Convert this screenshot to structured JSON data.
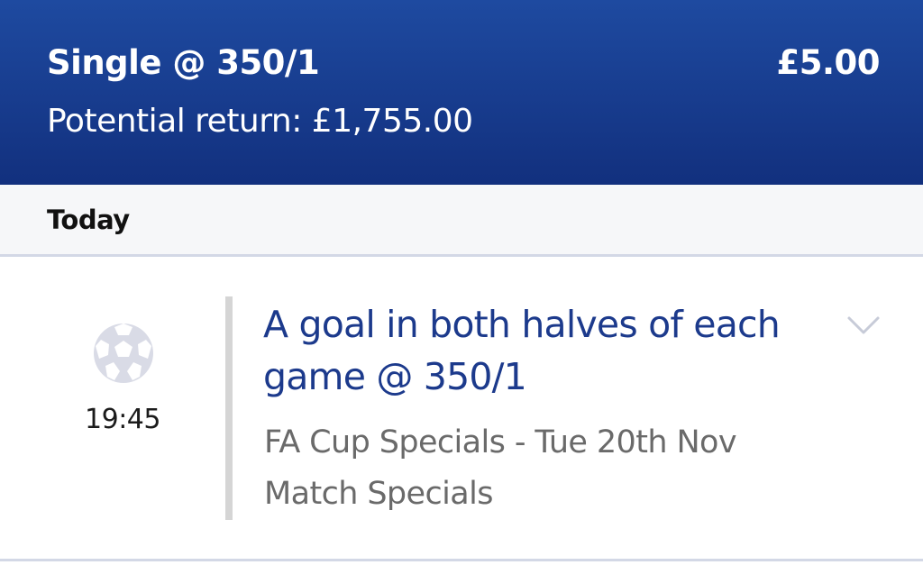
{
  "bet_slip": {
    "bet_type": "Single @ 350/1",
    "stake": "£5.00",
    "potential_return": "Potential return: £1,755.00"
  },
  "date_header": {
    "label": "Today"
  },
  "event": {
    "sport_icon": "football-icon",
    "kickoff_time": "19:45",
    "selection": "A goal in both halves of each game @ 350/1",
    "competition": "FA Cup Specials - Tue 20th Nov",
    "market": "Match Specials",
    "expand_icon": "chevron-down-icon"
  },
  "colors": {
    "header_bg": "#1a3f94",
    "selection_text": "#1c3a8c",
    "muted_text": "#6a6a6a",
    "icon_fill": "#d9dbe6"
  }
}
